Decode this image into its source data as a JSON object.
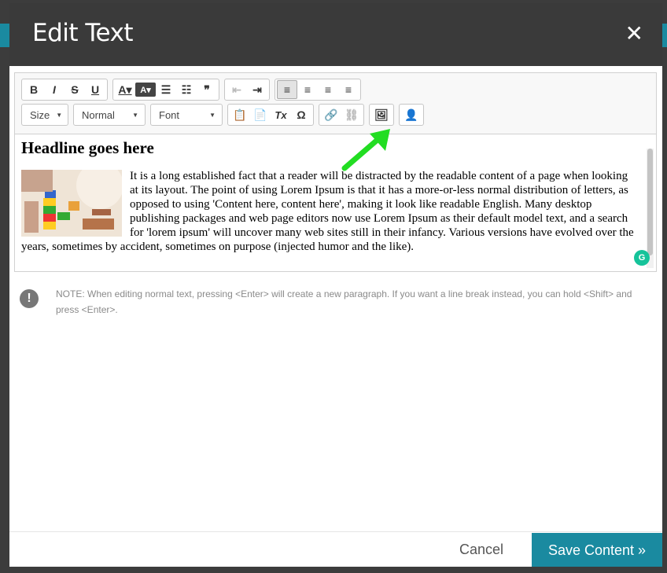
{
  "dialog": {
    "title": "Edit Text",
    "close_glyph": "✕"
  },
  "toolbar": {
    "row1_groups": [
      [
        {
          "name": "bold-button",
          "glyph": "B"
        },
        {
          "name": "italic-button",
          "glyph": "I"
        },
        {
          "name": "strikethrough-button",
          "glyph": "S"
        },
        {
          "name": "underline-button",
          "glyph": "U"
        }
      ],
      [
        {
          "name": "text-color-button",
          "glyph": "A▾"
        },
        {
          "name": "background-color-button",
          "glyph": "A▾"
        },
        {
          "name": "bulleted-list-button",
          "glyph": "☰"
        },
        {
          "name": "numbered-list-button",
          "glyph": "☷"
        },
        {
          "name": "blockquote-button",
          "glyph": "❞"
        }
      ],
      [
        {
          "name": "outdent-button",
          "glyph": "⇤"
        },
        {
          "name": "indent-button",
          "glyph": "⇥"
        }
      ],
      [
        {
          "name": "align-left-button",
          "glyph": "≡"
        },
        {
          "name": "align-center-button",
          "glyph": "≡"
        },
        {
          "name": "align-right-button",
          "glyph": "≡"
        },
        {
          "name": "justify-button",
          "glyph": "≡"
        }
      ]
    ],
    "size_label": "Size",
    "format_label": "Normal",
    "font_label": "Font",
    "row2_groups": [
      [
        {
          "name": "paste-button",
          "glyph": "📋"
        },
        {
          "name": "paste-from-word-button",
          "glyph": "📄"
        },
        {
          "name": "remove-format-button",
          "glyph": "Tx"
        },
        {
          "name": "special-character-button",
          "glyph": "Ω"
        }
      ],
      [
        {
          "name": "link-button",
          "glyph": "🔗"
        },
        {
          "name": "unlink-button",
          "glyph": "⛓"
        }
      ],
      [
        {
          "name": "image-button",
          "glyph": "🖼"
        }
      ],
      [
        {
          "name": "placeholder-person-button",
          "glyph": "👤"
        }
      ]
    ]
  },
  "content": {
    "headline": "Headline goes here",
    "paragraph": "It is a long established fact that a reader will be distracted by the readable content of a page when looking at its layout. The point of using Lorem Ipsum is that it has a more-or-less normal distribution of letters, as opposed to using 'Content here, content here', making it look like readable English. Many desktop publishing packages and web page editors now use Lorem Ipsum as their default model text, and a search for 'lorem ipsum' will uncover many web sites still in their infancy. Various versions have evolved over the years, sometimes by accident, sometimes on purpose (injected humor and the like)."
  },
  "note": {
    "icon_glyph": "!",
    "text": "NOTE: When editing normal text, pressing <Enter> will create a new paragraph. If you want a line break instead, you can hold <Shift> and press <Enter>."
  },
  "footer": {
    "cancel_label": "Cancel",
    "save_label": "Save Content »"
  },
  "colors": {
    "accent": "#1a8aa0",
    "header_bg": "#3a3a3a",
    "arrow": "#22dd22"
  }
}
